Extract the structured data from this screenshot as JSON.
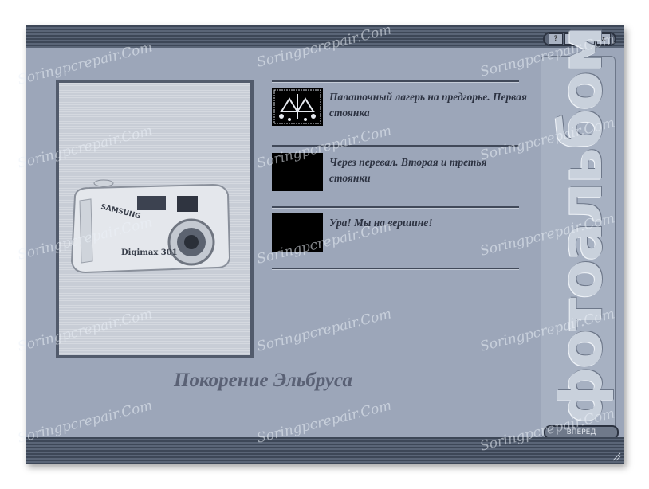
{
  "window": {
    "vertical_title": "фотоальбом",
    "buttons": {
      "help": "?",
      "minimize": "_",
      "maximize": "□",
      "close": "x"
    },
    "next_button": "ВПЕРЕД"
  },
  "album": {
    "cover_camera_brand": "SAMSUNG",
    "cover_camera_model": "Digimax 301",
    "title": "Покорение Эльбруса"
  },
  "items": [
    {
      "caption": "Палаточный лагерь на предгорье. Первая стоянка"
    },
    {
      "caption": "Через перевал. Вторая и третья стоянки"
    },
    {
      "caption": "Ура! Мы на вершине!"
    }
  ],
  "watermark": "Soringpcrepair.Com",
  "colors": {
    "window_bg": "#9ca6b9",
    "bar_dark": "#3d4757",
    "text": "#2d3342"
  }
}
